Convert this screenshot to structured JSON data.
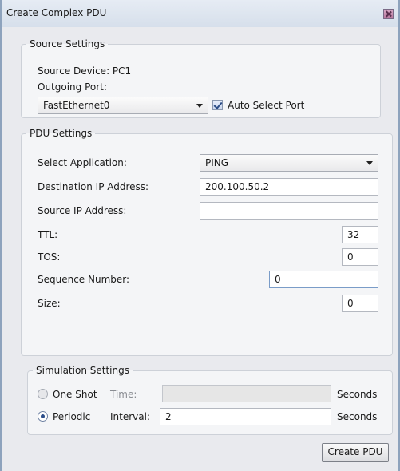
{
  "window": {
    "title": "Create Complex PDU"
  },
  "source": {
    "legend": "Source Settings",
    "device_label": "Source Device: PC1",
    "port_label": "Outgoing Port:",
    "port_value": "FastEthernet0",
    "auto_select_label": "Auto Select Port",
    "auto_select_checked": true
  },
  "pdu": {
    "legend": "PDU Settings",
    "application_label": "Select Application:",
    "application_value": "PING",
    "dest_ip_label": "Destination IP Address:",
    "dest_ip_value": "200.100.50.2",
    "src_ip_label": "Source IP Address:",
    "src_ip_value": "",
    "ttl_label": "TTL:",
    "ttl_value": "32",
    "tos_label": "TOS:",
    "tos_value": "0",
    "seq_label": "Sequence Number:",
    "seq_value": "0",
    "size_label": "Size:",
    "size_value": "0"
  },
  "simulation": {
    "legend": "Simulation Settings",
    "one_shot_label": "One Shot",
    "time_label": "Time:",
    "time_value": "",
    "seconds_label": "Seconds",
    "periodic_label": "Periodic",
    "interval_label": "Interval:",
    "interval_value": "2",
    "selected_mode": "Periodic"
  },
  "actions": {
    "create_label": "Create PDU"
  }
}
